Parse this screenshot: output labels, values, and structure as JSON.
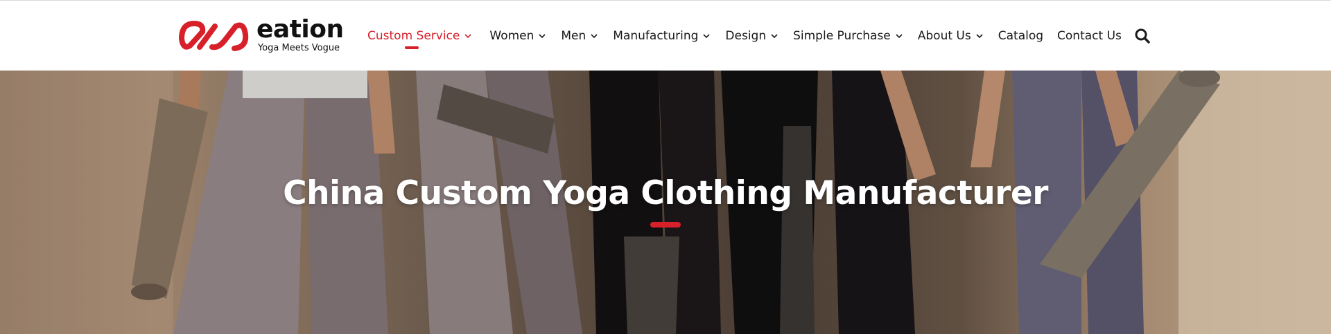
{
  "brand": {
    "name": "eation",
    "tagline": "Yoga Meets Vogue",
    "logo_icon": "eation-logo-mark",
    "accent_color": "#d8202a"
  },
  "nav": {
    "items": [
      {
        "label": "Custom Service",
        "has_dropdown": true,
        "active": true
      },
      {
        "label": "Women",
        "has_dropdown": true,
        "active": false
      },
      {
        "label": "Men",
        "has_dropdown": true,
        "active": false
      },
      {
        "label": "Manufacturing",
        "has_dropdown": true,
        "active": false
      },
      {
        "label": "Design",
        "has_dropdown": true,
        "active": false
      },
      {
        "label": "Simple Purchase",
        "has_dropdown": true,
        "active": false
      },
      {
        "label": "About Us",
        "has_dropdown": true,
        "active": false
      },
      {
        "label": "Catalog",
        "has_dropdown": false,
        "active": false
      },
      {
        "label": "Contact Us",
        "has_dropdown": false,
        "active": false
      }
    ],
    "search_icon": "search-icon"
  },
  "hero": {
    "title": "China Custom Yoga Clothing Manufacturer",
    "image": "women-in-leggings-holding-yoga-mats"
  }
}
